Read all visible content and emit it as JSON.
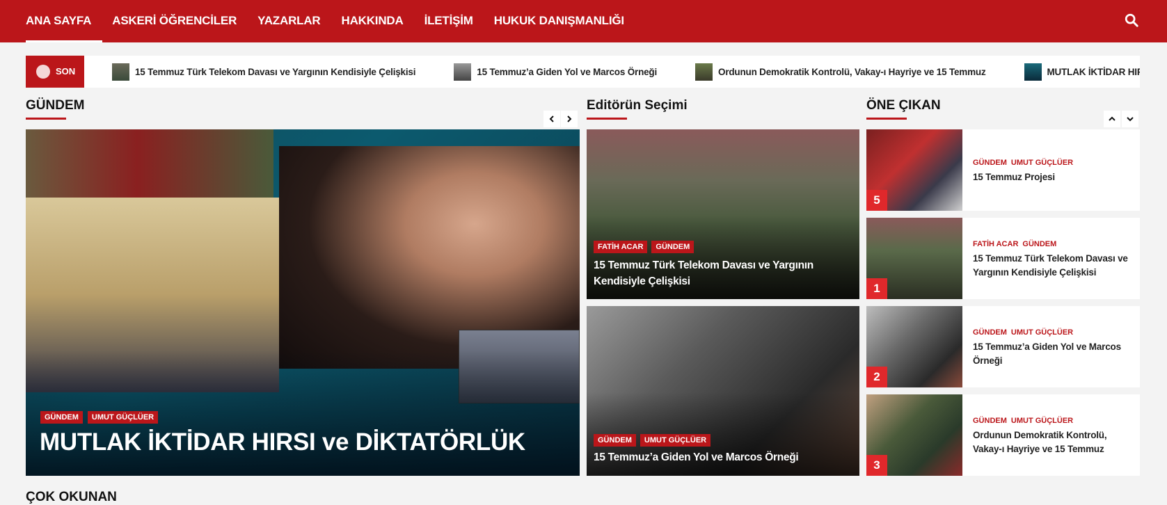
{
  "nav": {
    "items": [
      {
        "label": "ANA SAYFA",
        "active": true
      },
      {
        "label": "ASKERİ ÖĞRENCİLER",
        "active": false
      },
      {
        "label": "YAZARLAR",
        "active": false
      },
      {
        "label": "HAKKINDA",
        "active": false
      },
      {
        "label": "İLETİŞİM",
        "active": false
      },
      {
        "label": "HUKUK DANIŞMANLIĞI",
        "active": false
      }
    ],
    "search_icon": "search-icon"
  },
  "ticker": {
    "label": "SON",
    "items": [
      {
        "text": "15 Temmuz Türk Telekom Davası ve Yargının Kendisiyle Çelişkisi"
      },
      {
        "text": "15 Temmuz’a Giden Yol ve Marcos Örneği"
      },
      {
        "text": "Ordunun Demokratik Kontrolü, Vakay-ı Hayriye ve 15 Temmuz"
      },
      {
        "text": "MUTLAK İKTİDAR HIRSI ve DİKTATÖRLÜK"
      }
    ]
  },
  "gundem": {
    "title": "GÜNDEM",
    "hero": {
      "categories": [
        "GÜNDEM",
        "UMUT GÜÇLÜER"
      ],
      "title": "MUTLAK İKTİDAR HIRSI ve DİKTATÖRLÜK"
    }
  },
  "editor": {
    "title": "Editörün Seçimi",
    "cards": [
      {
        "categories": [
          "FATİH ACAR",
          "GÜNDEM"
        ],
        "title": "15 Temmuz Türk Telekom Davası ve Yargının Kendisiyle Çelişkisi"
      },
      {
        "categories": [
          "GÜNDEM",
          "UMUT GÜÇLÜER"
        ],
        "title": "15 Temmuz’a Giden Yol ve Marcos Örneği"
      }
    ]
  },
  "one_cikan": {
    "title": "ÖNE ÇIKAN",
    "items": [
      {
        "rank": "5",
        "meta": [
          "GÜNDEM",
          "UMUT GÜÇLÜER"
        ],
        "title": "15 Temmuz Projesi"
      },
      {
        "rank": "1",
        "meta": [
          "FATİH ACAR",
          "GÜNDEM"
        ],
        "title": "15 Temmuz Türk Telekom Davası ve Yargının Kendisiyle Çelişkisi"
      },
      {
        "rank": "2",
        "meta": [
          "GÜNDEM",
          "UMUT GÜÇLÜER"
        ],
        "title": "15 Temmuz’a Giden Yol ve Marcos Örneği"
      },
      {
        "rank": "3",
        "meta": [
          "GÜNDEM",
          "UMUT GÜÇLÜER"
        ],
        "title": "Ordunun Demokratik Kontrolü, Vakay-ı Hayriye ve 15 Temmuz"
      }
    ]
  },
  "cok_okunan": {
    "title": "ÇOK OKUNAN"
  },
  "colors": {
    "brand_red": "#bb161a",
    "rank_red": "#e0282b",
    "background": "#f3f3f3"
  }
}
